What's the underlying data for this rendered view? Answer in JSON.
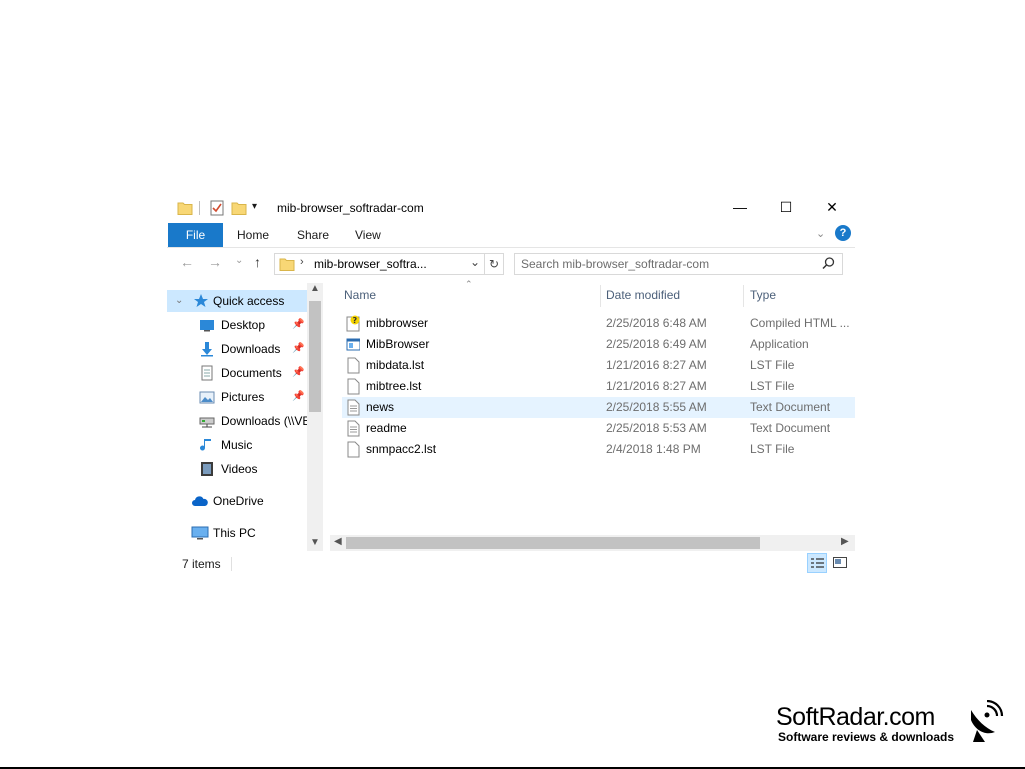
{
  "window": {
    "title": "mib-browser_softradar-com",
    "controls": {
      "minimize": "—",
      "maximize": "☐",
      "close": "✕"
    }
  },
  "ribbon": {
    "tabs": [
      "File",
      "Home",
      "Share",
      "View"
    ],
    "help": "?"
  },
  "address": {
    "path": "mib-browser_softra...",
    "search_placeholder": "Search mib-browser_softradar-com"
  },
  "nav": {
    "quick_access": "Quick access",
    "items": [
      {
        "label": "Desktop",
        "pinned": true
      },
      {
        "label": "Downloads",
        "pinned": true
      },
      {
        "label": "Documents",
        "pinned": true
      },
      {
        "label": "Pictures",
        "pinned": true
      },
      {
        "label": "Downloads (\\\\VBoxSvr)",
        "pinned": false
      },
      {
        "label": "Music",
        "pinned": false
      },
      {
        "label": "Videos",
        "pinned": false
      }
    ],
    "onedrive": "OneDrive",
    "this_pc": "This PC"
  },
  "columns": {
    "name": "Name",
    "date": "Date modified",
    "type": "Type"
  },
  "files": [
    {
      "name": "mibbrowser",
      "date": "2/25/2018 6:48 AM",
      "type": "Compiled HTML ...",
      "icon": "chm-help-icon"
    },
    {
      "name": "MibBrowser",
      "date": "2/25/2018 6:49 AM",
      "type": "Application",
      "icon": "application-icon"
    },
    {
      "name": "mibdata.lst",
      "date": "1/21/2016 8:27 AM",
      "type": "LST File",
      "icon": "blank-file-icon"
    },
    {
      "name": "mibtree.lst",
      "date": "1/21/2016 8:27 AM",
      "type": "LST File",
      "icon": "blank-file-icon"
    },
    {
      "name": "news",
      "date": "2/25/2018 5:55 AM",
      "type": "Text Document",
      "icon": "text-file-icon"
    },
    {
      "name": "readme",
      "date": "2/25/2018 5:53 AM",
      "type": "Text Document",
      "icon": "text-file-icon"
    },
    {
      "name": "snmpacc2.lst",
      "date": "2/4/2018 1:48 PM",
      "type": "LST File",
      "icon": "blank-file-icon"
    }
  ],
  "status": {
    "count": "7 items"
  },
  "watermark": {
    "title": "SoftRadar.com",
    "subtitle": "Software reviews & downloads"
  },
  "colors": {
    "accent": "#1979ca",
    "selection": "#cce8ff",
    "hover": "#e5f3ff",
    "folder": "#f8d775"
  }
}
